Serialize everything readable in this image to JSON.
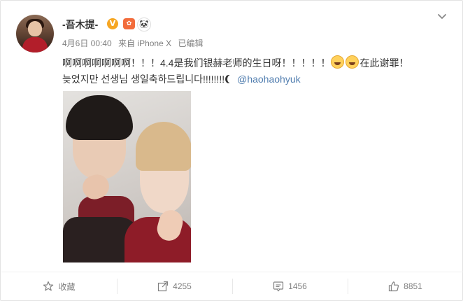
{
  "post": {
    "username": "-吾木提-",
    "verified_mark": "V",
    "badge_two": "✿",
    "badge_three": "🐼",
    "date": "4月6日 00:40",
    "source": "来自 iPhone X",
    "edited": "已编辑",
    "line1_text": "啊啊啊啊啊啊啊！！！4.4是我们银赫老师的生日呀！！！！！",
    "line1_tail": "在此谢罪！",
    "line2_text": "늦었지만 선생님 생일축하드립니다!!!!!!!!",
    "mention": "@haohaohyuk"
  },
  "actions": {
    "favorite_label": "收藏",
    "repost_count": "4255",
    "comment_count": "1456",
    "like_count": "8851"
  },
  "icons": {
    "more": "chevron-down-icon",
    "favorite": "star-icon",
    "repost": "share-arrow-icon",
    "comment": "comment-icon",
    "like": "thumbs-up-icon"
  },
  "colors": {
    "mention": "#507daf",
    "verified": "#f6a623",
    "meta_text": "#808080"
  }
}
